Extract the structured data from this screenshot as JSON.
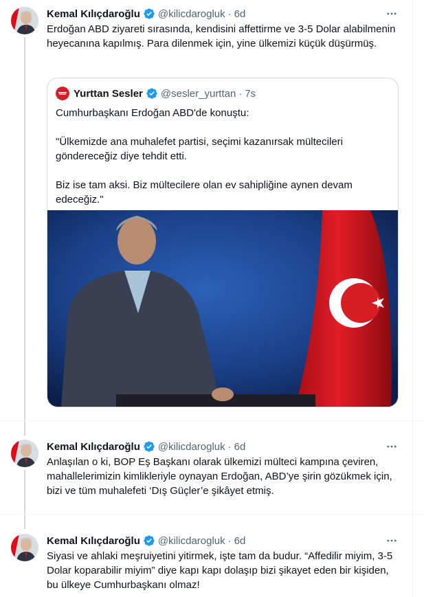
{
  "tweets": [
    {
      "name": "Kemal Kılıçdaroğlu",
      "handle": "@kilicdarogluk",
      "dot": "·",
      "time": "6d",
      "text": "Erdoğan ABD ziyareti sırasında, kendisini affettirme ve 3-5 Dolar alabilmenin heyecanına kapılmış. Para dilenmek için, yine ülkemizi küçük düşürmüş.",
      "quote": {
        "name": "Yurttan Sesler",
        "handle": "@sesler_yurttan",
        "dot": "·",
        "time": "7s",
        "para1": "Cumhurbaşkanı Erdoğan ABD'de konuştu:",
        "para2": "\"Ülkemizde ana muhalefet partisi, seçimi kazanırsak mültecileri göndereceğiz diye tehdit etti.",
        "para3": "Biz ise tam aksi. Biz mültecilere olan ev sahipliğine aynen devam edeceğiz.\""
      }
    },
    {
      "name": "Kemal Kılıçdaroğlu",
      "handle": "@kilicdarogluk",
      "dot": "·",
      "time": "6d",
      "text": "Anlaşılan o ki, BOP Eş Başkanı olarak ülkemizi mülteci kampına çeviren, mahallelerimizin kimlikleriyle oynayan Erdoğan, ABD’ye şirin gözükmek için, bizi ve tüm muhalefeti ‘Dış Güçler’e şikâyet etmiş."
    },
    {
      "name": "Kemal Kılıçdaroğlu",
      "handle": "@kilicdarogluk",
      "dot": "·",
      "time": "6d",
      "text": "Siyasi ve ahlaki meşruiyetini yitirmek, işte tam da budur. “Affedilir miyim, 3-5 Dolar koparabilir miyim” diye kapı kapı dolaşıp bizi şikayet eden bir kişiden, bu ülkeye Cumhurbaşkanı olmaz!"
    }
  ],
  "colors": {
    "verified": "#1d9bf0",
    "secondary_text": "#536471",
    "border": "#cfd9de"
  },
  "icons": {
    "verified": "verified-badge-icon",
    "more": "more-horizontal-icon"
  }
}
